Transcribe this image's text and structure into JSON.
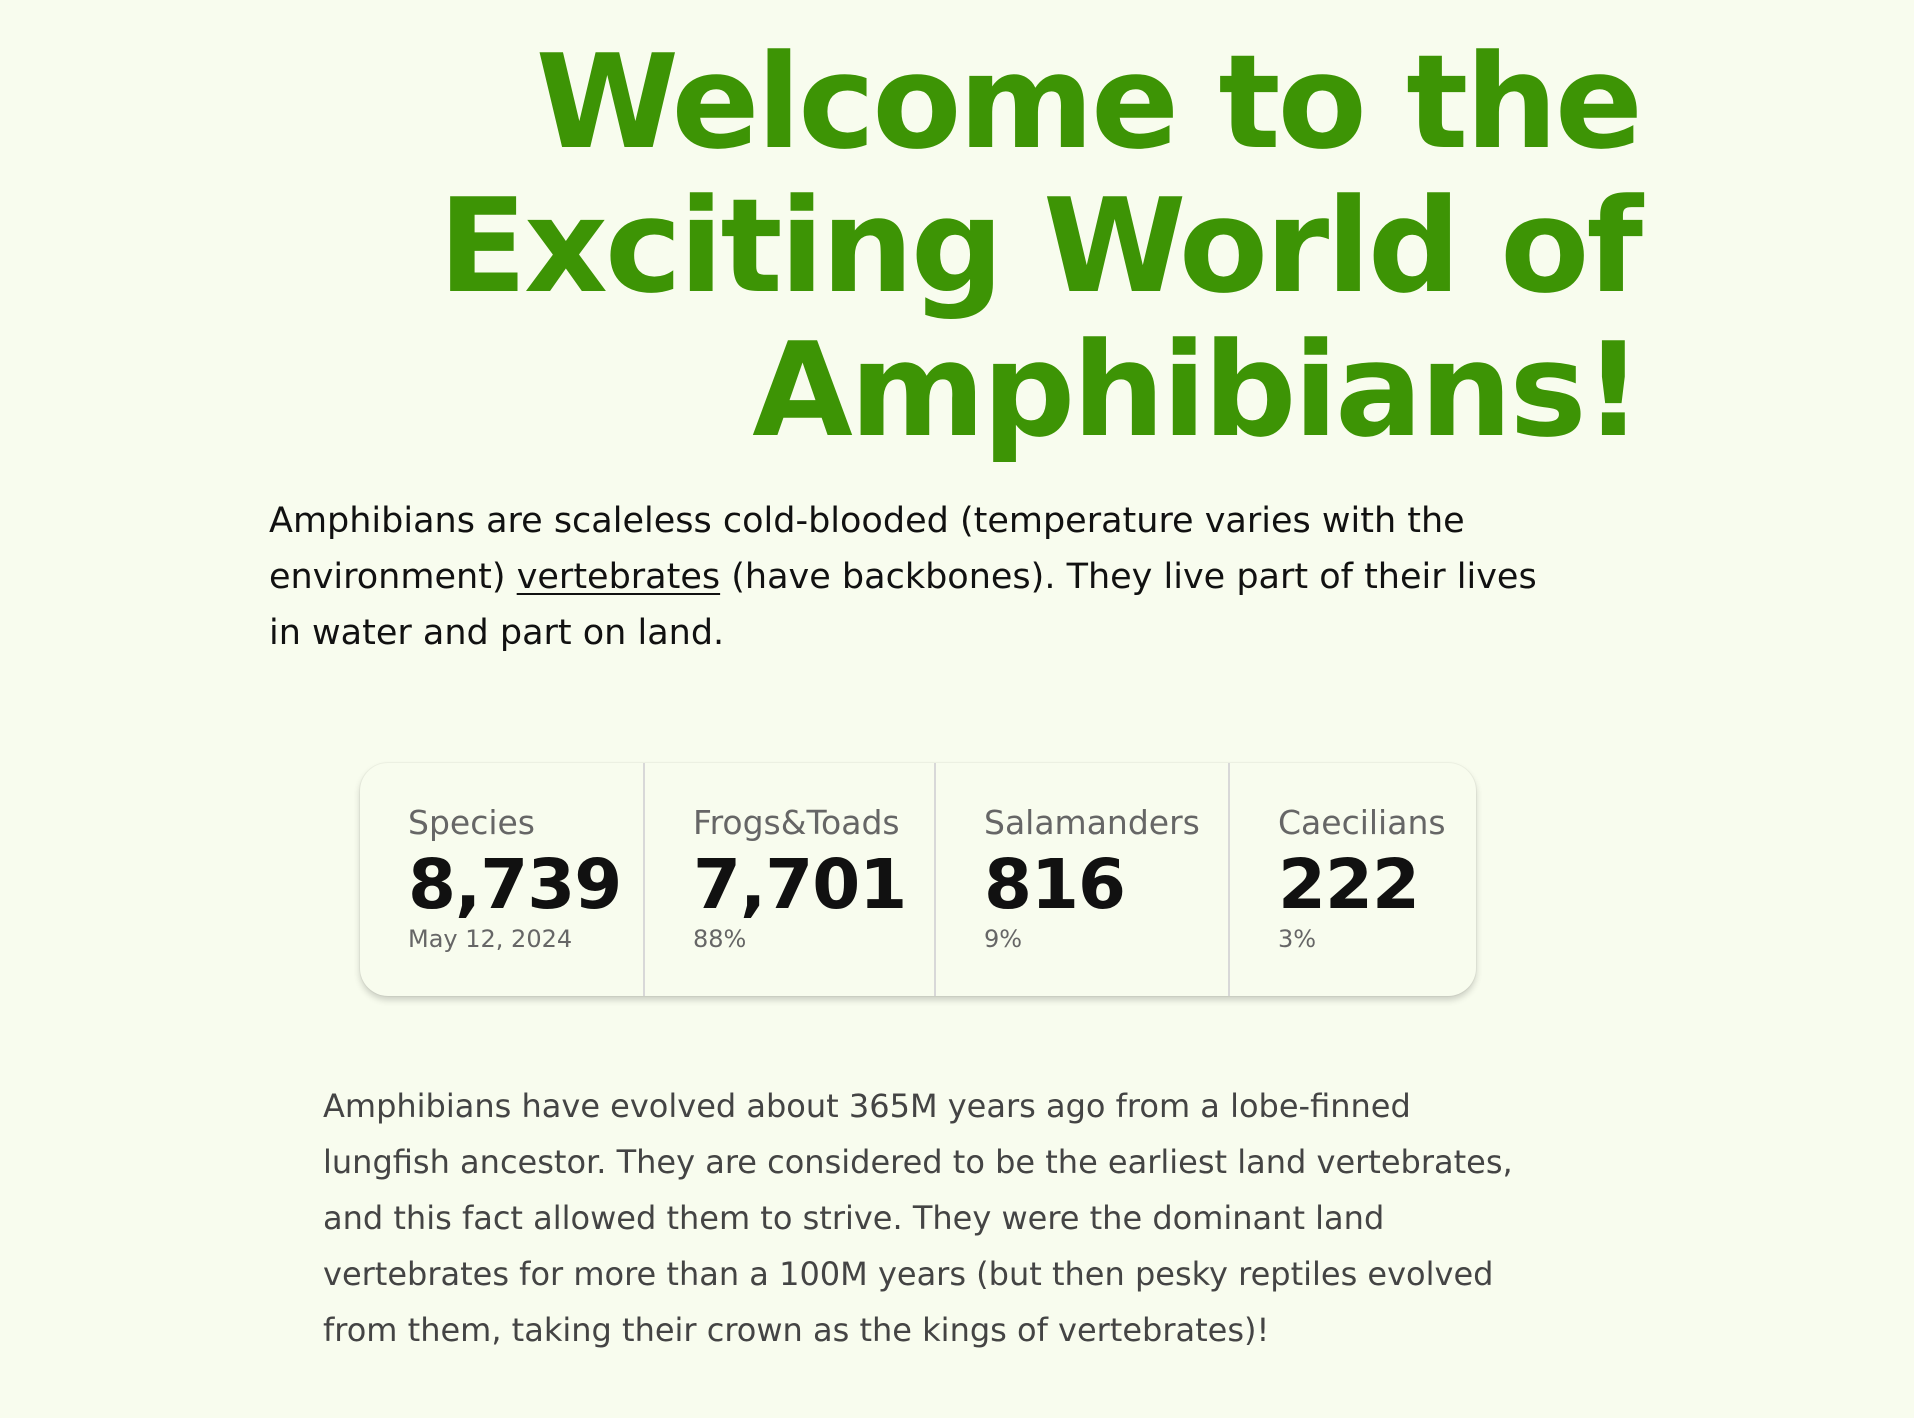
{
  "hero": {
    "title_line_1": "Welcome to the",
    "title_line_2": "Exciting World of",
    "title_line_3": "Amphibians!"
  },
  "intro": {
    "before_link": "Amphibians are scaleless cold-blooded (temperature varies with the environment) ",
    "link_text": "vertebrates",
    "after_link": " (have backbones). They live part of their lives in water and part on land."
  },
  "stats": [
    {
      "label": "Species",
      "value": "8,739",
      "note": "May 12, 2024"
    },
    {
      "label": "Frogs&Toads",
      "value": "7,701",
      "note": "88%"
    },
    {
      "label": "Salamanders",
      "value": "816",
      "note": "9%"
    },
    {
      "label": "Caecilians",
      "value": "222",
      "note": "3%"
    }
  ],
  "history": {
    "text": "Amphibians have evolved about 365M years ago from a lobe-finned lungfish ancestor. They are considered to be the earliest land vertebrates, and this fact allowed them to strive. They were the dominant land vertebrates for more than a 100M years (but then pesky reptiles evolved from them, taking their crown as the kings of vertebrates)!"
  },
  "colors": {
    "background": "#f8fcee",
    "title_green": "#3d9405",
    "body_text": "#111111",
    "muted_text": "#666666",
    "history_text": "#444444"
  }
}
